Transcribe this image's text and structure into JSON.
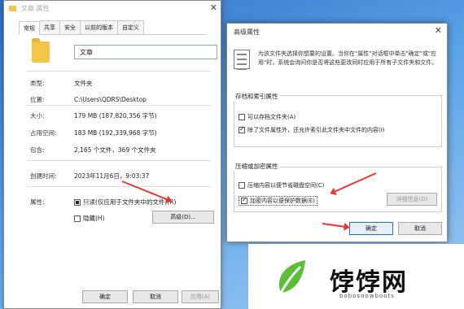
{
  "props": {
    "title": "文章 属性",
    "tabs": [
      "常规",
      "共享",
      "安全",
      "以前的版本",
      "自定义"
    ],
    "folder_name": "文章",
    "rows": [
      {
        "label": "类型:",
        "value": "文件夹"
      },
      {
        "label": "位置:",
        "value": "C:\\Users\\QDRS\\Desktop"
      },
      {
        "label": "大小:",
        "value": "179 MB (187,820,356 字节)"
      },
      {
        "label": "占用空间:",
        "value": "183 MB (192,339,968 字节)"
      },
      {
        "label": "包含:",
        "value": "2,165 个文件，369 个文件夹"
      },
      {
        "label": "创建时间:",
        "value": "2023年11月6日，9:03:37"
      }
    ],
    "attr_label": "属性:",
    "readonly_label": "只读(仅应用于文件夹中的文件)(R)",
    "hidden_label": "隐藏(H)",
    "advanced_btn": "高级(D)...",
    "ok": "确定",
    "cancel": "取消",
    "apply": "应用(A)"
  },
  "advanced": {
    "title": "高级属性",
    "desc": "为该文件夹选择你想要的设置。当你在\"属性\"对话框中单击\"确定\"或\"应用\"时，系统会询问你是否将这些更改同时应用于所有子文件夹和文件。",
    "group1_title": "存档和索引属性",
    "archive_label": "可以存档文件夹(A)",
    "index_label": "除了文件属性外，还允许索引此文件夹中文件的内容(I)",
    "group2_title": "压缩或加密属性",
    "compress_label": "压缩内容以便节省磁盘空间(C)",
    "encrypt_label": "加密内容以便保护数据(E)",
    "details_btn": "详细信息(D)",
    "ok": "确定",
    "cancel": "取消"
  },
  "watermark": {
    "brand": "饽饽网",
    "url": "bobosnowboots"
  }
}
